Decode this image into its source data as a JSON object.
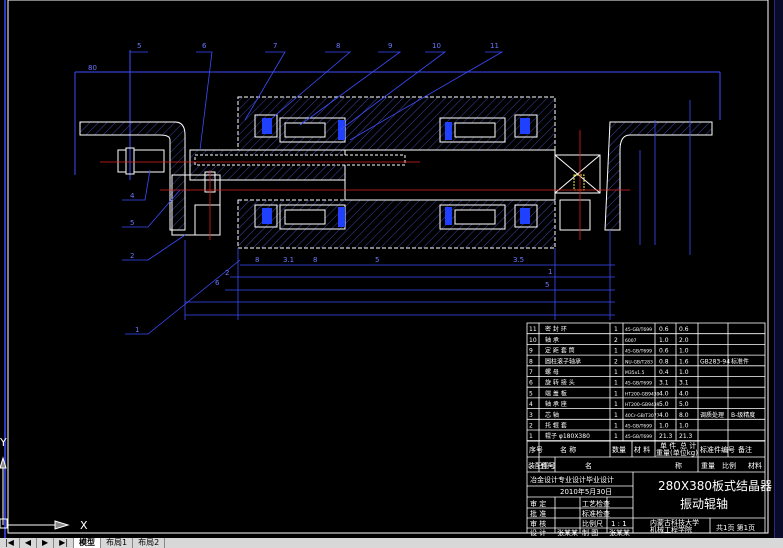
{
  "drawing": {
    "part_labels_top": [
      "5",
      "6",
      "7",
      "8",
      "9",
      "10",
      "11"
    ],
    "part_labels_left": [
      "4",
      "5",
      "2",
      "1"
    ],
    "dimensions": [
      "80",
      "8",
      "3.5",
      "1",
      "5",
      "2",
      "6",
      "3.1",
      "8",
      "5"
    ],
    "ucs": {
      "x_label": "X",
      "y_label": "Y"
    }
  },
  "parts_list": {
    "rows": [
      {
        "no": "11",
        "name": "密 封 环",
        "qty": "1",
        "material": "45-GB/T699",
        "unit": "0.6",
        "total": "0.6",
        "std": "",
        "note": ""
      },
      {
        "no": "10",
        "name": "轴    承",
        "qty": "2",
        "material": "6007",
        "unit": "1.0",
        "total": "2.0",
        "std": "",
        "note": ""
      },
      {
        "no": "9",
        "name": "定 距 套 筒",
        "qty": "1",
        "material": "45-GB/T699",
        "unit": "0.6",
        "total": "1.0",
        "std": "",
        "note": ""
      },
      {
        "no": "8",
        "name": "圆柱滚子轴承",
        "qty": "2",
        "material": "NU-GB/T283",
        "unit": "0.8",
        "total": "1.6",
        "std": "GB283-94",
        "note": "标准件"
      },
      {
        "no": "7",
        "name": "螺    母",
        "qty": "1",
        "material": "M35x1.5",
        "unit": "0.4",
        "total": "1.0",
        "std": "",
        "note": ""
      },
      {
        "no": "6",
        "name": "旋 转 接 头",
        "qty": "1",
        "material": "45-GB/T699",
        "unit": "3.1",
        "total": "3.1",
        "std": "",
        "note": ""
      },
      {
        "no": "5",
        "name": "端 盖 板",
        "qty": "1",
        "material": "HT200-GB9439",
        "unit": "4.0",
        "total": "4.0",
        "std": "",
        "note": ""
      },
      {
        "no": "4",
        "name": "轴 承 座",
        "qty": "1",
        "material": "HT200-GB9439",
        "unit": "5.0",
        "total": "5.0",
        "std": "",
        "note": ""
      },
      {
        "no": "3",
        "name": "芯    轴",
        "qty": "1",
        "material": "40Cr-GB/T3077",
        "unit": "4.0",
        "total": "8.0",
        "std": "调质处理",
        "note": "B-级精度"
      },
      {
        "no": "2",
        "name": "托 辊 套",
        "qty": "1",
        "material": "45-GB/T699",
        "unit": "1.0",
        "total": "1.0",
        "std": "",
        "note": ""
      },
      {
        "no": "1",
        "name": "辊子 φ180X380",
        "qty": "1",
        "material": "45-GB/T699",
        "unit": "21.3",
        "total": "21.3",
        "std": "",
        "note": ""
      }
    ],
    "header": [
      "序号",
      "名    称",
      "数量",
      "材    料",
      "单 件",
      "总 计",
      "标准件编号",
      "备注"
    ],
    "header_sub": "重量(单位kg)"
  },
  "title_block": {
    "row_assembly": [
      "装配图号",
      "件号",
      "名",
      "称",
      "重量",
      "比例",
      "材料"
    ],
    "school": "冶金设计专业设计毕业设计",
    "date": "2010年5月30日",
    "title_line1": "280X380板式结晶器",
    "title_line2": "振动辊轴",
    "labels": [
      "审 定",
      "批 准",
      "审 核",
      "设 计"
    ],
    "fields": [
      "工艺检查",
      "标准检查",
      "比例尺",
      "制 图"
    ],
    "scale": "1 : 1",
    "designer": "张某某",
    "drafter": "张某某",
    "university": "内蒙古科技大学",
    "department": "机械工程学院",
    "sheet": "共1页 第1页"
  },
  "statusbar": {
    "tabs": [
      "模型",
      "布局1",
      "布局2"
    ],
    "active_tab": "模型"
  },
  "colors": {
    "line": "#ffffff",
    "dim": "#3c4cff",
    "center": "#e02020",
    "hatch": "#5060d8",
    "bearing": "#2040ff"
  }
}
